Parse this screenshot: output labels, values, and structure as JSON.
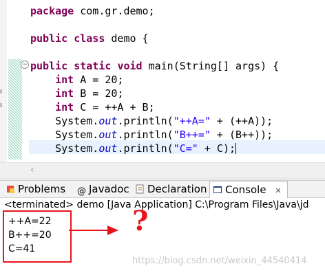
{
  "editor": {
    "lines": [
      {
        "seg": [
          {
            "t": "package",
            "c": "kw"
          },
          {
            "t": " com.gr.demo;"
          }
        ]
      },
      {
        "seg": [
          {
            "t": "public",
            "c": "kw"
          },
          {
            "t": " "
          },
          {
            "t": "class",
            "c": "kw"
          },
          {
            "t": " demo {"
          }
        ]
      },
      {
        "seg": [
          {
            "t": "public",
            "c": "kw"
          },
          {
            "t": " "
          },
          {
            "t": "static",
            "c": "kw"
          },
          {
            "t": " "
          },
          {
            "t": "void",
            "c": "kw"
          },
          {
            "t": " main(String[] args) {"
          }
        ]
      },
      {
        "seg": [
          {
            "t": "    "
          },
          {
            "t": "int",
            "c": "kw"
          },
          {
            "t": " A = 20;"
          }
        ]
      },
      {
        "seg": [
          {
            "t": "    "
          },
          {
            "t": "int",
            "c": "kw"
          },
          {
            "t": " B = 20;"
          }
        ]
      },
      {
        "seg": [
          {
            "t": "    "
          },
          {
            "t": "int",
            "c": "kw"
          },
          {
            "t": " C = ++A + B;"
          }
        ]
      },
      {
        "seg": [
          {
            "t": "    System."
          },
          {
            "t": "out",
            "c": "fld"
          },
          {
            "t": ".println("
          },
          {
            "t": "\"++A=\"",
            "c": "str"
          },
          {
            "t": " + (++A));"
          }
        ]
      },
      {
        "seg": [
          {
            "t": "    System."
          },
          {
            "t": "out",
            "c": "fld"
          },
          {
            "t": ".println("
          },
          {
            "t": "\"B++=\"",
            "c": "str"
          },
          {
            "t": " + (B++));"
          }
        ]
      },
      {
        "seg": [
          {
            "t": "    System."
          },
          {
            "t": "out",
            "c": "fld"
          },
          {
            "t": ".println("
          },
          {
            "t": "\"C=\"",
            "c": "str"
          },
          {
            "t": " + C);"
          }
        ]
      }
    ]
  },
  "tabs": [
    {
      "label": "Problems",
      "icon": "problems-icon"
    },
    {
      "label": "Javadoc",
      "icon": "javadoc-icon"
    },
    {
      "label": "Declaration",
      "icon": "declaration-icon"
    },
    {
      "label": "Console",
      "icon": "console-icon",
      "close": "✕"
    }
  ],
  "console": {
    "terminated": "<terminated> demo [Java Application] C:\\Program Files\\Java\\jd",
    "output": [
      "++A=22",
      "B++=20",
      "C=41"
    ]
  },
  "annotation": {
    "mark": "?"
  },
  "watermark": "https://blog.csdn.net/weixin_44540414",
  "colors": {
    "keyword": "#7f0055",
    "string": "#2a00ff",
    "field": "#0000c0",
    "annotation": "#e8141b"
  }
}
